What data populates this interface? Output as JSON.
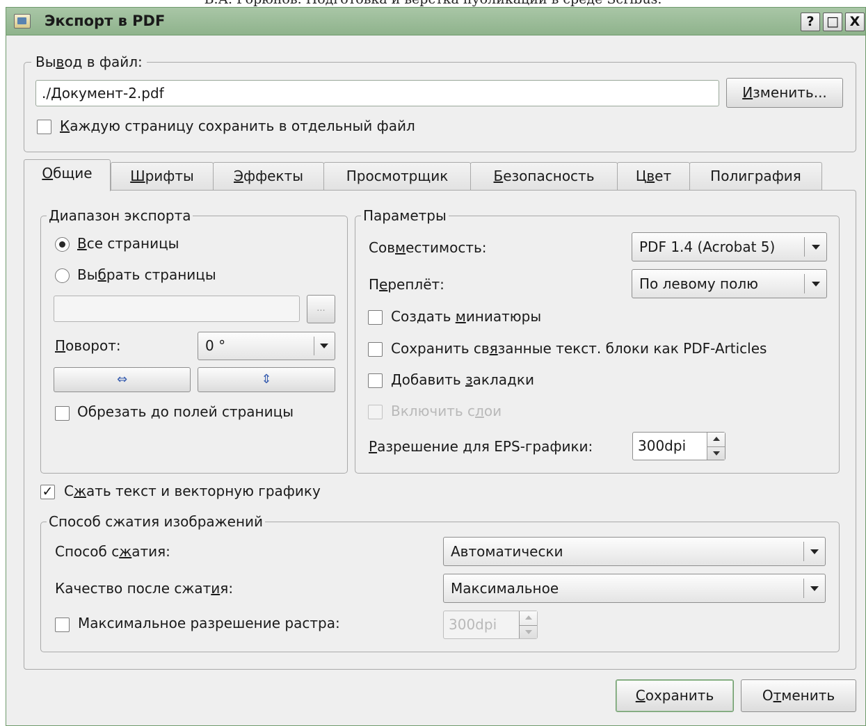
{
  "page_caption": "В.А. Горюнов. Подготовка и вёрстка публикации в среде Scribus.",
  "window": {
    "title": "Экспорт в PDF",
    "help_label": "?",
    "maximize_label": "□",
    "close_label": "X"
  },
  "output": {
    "legend_pre": "Вы",
    "legend_acc": "в",
    "legend_post": "од в файл:",
    "file_value": "./Документ-2.pdf",
    "change_pre": "",
    "change_acc": "И",
    "change_post": "зменить...",
    "separate_pre": "",
    "separate_acc": "К",
    "separate_post": "аждую страницу сохранить в отдельный файл",
    "separate_checked": false
  },
  "tabs": [
    {
      "pre": "",
      "acc": "О",
      "post": "бщие",
      "active": true
    },
    {
      "pre": "",
      "acc": "Ш",
      "post": "рифты"
    },
    {
      "pre": "",
      "acc": "Э",
      "post": "ффекты"
    },
    {
      "pre": "Просмотрщик",
      "acc": "",
      "post": ""
    },
    {
      "pre": "",
      "acc": "Б",
      "post": "езопасность"
    },
    {
      "pre": "Ц",
      "acc": "в",
      "post": "ет"
    },
    {
      "pre": "Полиграфия",
      "acc": "",
      "post": ""
    }
  ],
  "export_range": {
    "legend": "Диапазон экспорта",
    "all_pre": "",
    "all_acc": "В",
    "all_post": "се страницы",
    "select_pre": "Вы",
    "select_acc": "б",
    "select_post": "рать страницы",
    "pages_value": "",
    "browse_label": "...",
    "rotation_pre": "",
    "rotation_acc": "П",
    "rotation_post": "оворот:",
    "rotation_value": "0 °",
    "flip_h_icon": "⇔",
    "flip_v_icon": "⇕",
    "clip_label": "Обрезать до полей страницы"
  },
  "params": {
    "legend": "Параметры",
    "compat_pre": "Сов",
    "compat_acc": "м",
    "compat_post": "естимость:",
    "compat_value": "PDF 1.4 (Acrobat 5)",
    "binding_pre": "П",
    "binding_acc": "е",
    "binding_post": "реплёт:",
    "binding_value": "По левому полю",
    "thumbs_pre": "Создать ",
    "thumbs_acc": "м",
    "thumbs_post": "иниатюры",
    "articles_pre": "Сохранить св",
    "articles_acc": "я",
    "articles_post": "занные текст. блоки как PDF-Articles",
    "bookmarks_pre": "Добавить ",
    "bookmarks_acc": "з",
    "bookmarks_post": "акладки",
    "layers_pre": "Включить с",
    "layers_acc": "л",
    "layers_post": "ои",
    "eps_pre": "",
    "eps_acc": "Р",
    "eps_post": "азрешение для EPS-графики:",
    "eps_value": "300dpi"
  },
  "compress_text": {
    "pre": "С",
    "acc": "ж",
    "post": "ать текст и векторную графику",
    "checked": true
  },
  "image_compression": {
    "legend": "Способ сжатия изображений",
    "method_pre": "Способ с",
    "method_acc": "ж",
    "method_post": "атия:",
    "method_value": "Автоматически",
    "quality_pre": "Качество после сжат",
    "quality_acc": "и",
    "quality_post": "я:",
    "quality_value": "Максимальное",
    "maxres_label": "Максимальное разрешение растра:",
    "maxres_value": "300dpi"
  },
  "buttons": {
    "save_pre": "",
    "save_acc": "С",
    "save_post": "охранить",
    "cancel_pre": "О",
    "cancel_acc": "т",
    "cancel_post": "менить"
  }
}
